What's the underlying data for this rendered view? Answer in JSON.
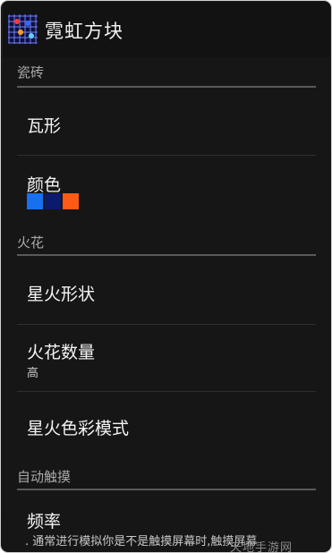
{
  "app": {
    "title": "霓虹方块"
  },
  "sections": {
    "tiles": {
      "header": "瓷砖"
    },
    "sparks": {
      "header": "火花"
    },
    "auto_touch": {
      "header": "自动触摸"
    }
  },
  "items": {
    "tile_shape": {
      "title": "瓦形"
    },
    "color": {
      "title": "颜色",
      "swatches": [
        "#1670f0",
        "#0c1a6e",
        "#ff5a14"
      ]
    },
    "spark_shape": {
      "title": "星火形状"
    },
    "spark_count": {
      "title": "火花数量",
      "value": "高"
    },
    "spark_color_mode": {
      "title": "星火色彩模式"
    },
    "frequency": {
      "title": "频率",
      "summary": ". 通常进行模拟你是不是触摸屏幕时,触摸屏幕"
    }
  },
  "watermark": {
    "text": "天地手游网"
  }
}
